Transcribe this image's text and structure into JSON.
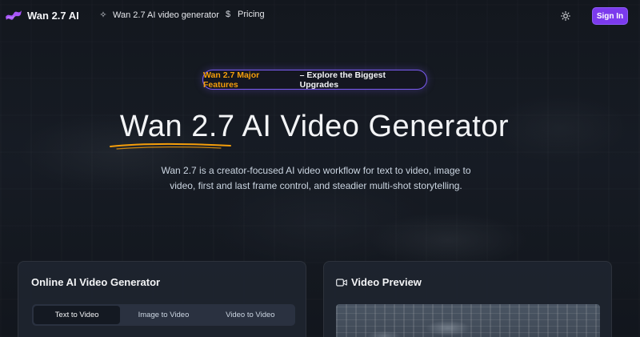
{
  "header": {
    "brand_name": "Wan 2.7 AI",
    "nav": [
      {
        "label": "Wan 2.7 AI video generator",
        "icon": "sparkles-icon"
      },
      {
        "label": "Pricing",
        "icon": "dollar-icon"
      }
    ],
    "theme_icon": "sun-icon",
    "signin_label": "Sign In"
  },
  "hero": {
    "announcement_highlight": "Wan 2.7 Major Features",
    "announcement_rest": "– Explore the Biggest Upgrades",
    "title": "Wan 2.7 AI Video Generator",
    "description": "Wan 2.7 is a creator-focused AI video workflow for text to video, image to video, first and last frame control, and steadier multi-shot storytelling."
  },
  "generator_card": {
    "title": "Online AI Video Generator",
    "tabs": [
      {
        "label": "Text to Video",
        "active": true
      },
      {
        "label": "Image to Video",
        "active": false
      },
      {
        "label": "Video to Video",
        "active": false
      }
    ]
  },
  "preview_card": {
    "title": "Video Preview",
    "icon": "video-camera-icon"
  },
  "colors": {
    "accent": "#7c3aed",
    "highlight": "#f59e0b",
    "underline": "#f59e0b"
  }
}
